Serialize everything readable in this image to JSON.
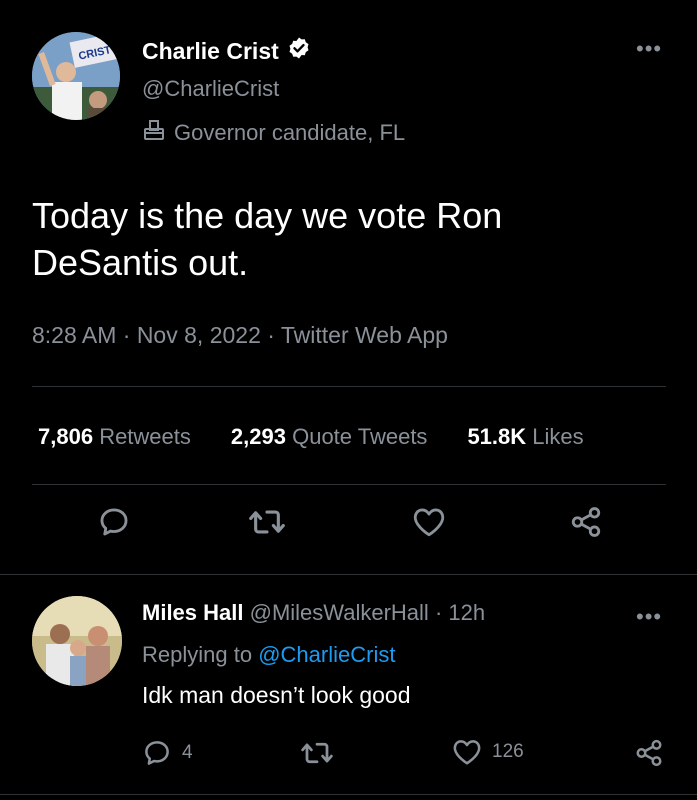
{
  "tweet": {
    "author_name": "Charlie Crist",
    "author_handle": "@CharlieCrist",
    "label": "Governor candidate, FL",
    "text": "Today is the day we vote Ron DeSantis out.",
    "meta": "8:28 AM · Nov 8, 2022 · Twitter Web App",
    "stats": {
      "retweets_count": "7,806",
      "retweets_label": "Retweets",
      "quotes_count": "2,293",
      "quotes_label": "Quote Tweets",
      "likes_count": "51.8K",
      "likes_label": "Likes"
    },
    "avatar_sign_text": "CRIST"
  },
  "reply": {
    "author_name": "Miles Hall",
    "author_handle": "@MilesWalkerHall",
    "separator": "·",
    "time": "12h",
    "replying_prefix": "Replying to",
    "replying_to": "@CharlieCrist",
    "text": "Idk man doesn’t look good",
    "reply_count": "4",
    "like_count": "126"
  },
  "colors": {
    "background": "#000000",
    "secondary_text": "#8b9199",
    "accent": "#1d9bf0",
    "divider": "#2f3336"
  }
}
